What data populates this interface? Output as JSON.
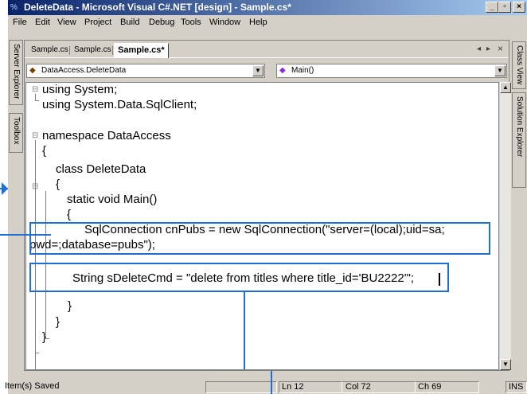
{
  "window": {
    "title": "DeleteData - Microsoft Visual C#.NET [design] - Sample.cs*",
    "controls": {
      "minimize": "_",
      "maximize": "▫",
      "close": "×"
    }
  },
  "menu": [
    {
      "label": "File"
    },
    {
      "label": "Edit"
    },
    {
      "label": "View"
    },
    {
      "label": "Project"
    },
    {
      "label": "Build"
    },
    {
      "label": "Debug"
    },
    {
      "label": "Tools"
    },
    {
      "label": "Window"
    },
    {
      "label": "Help"
    }
  ],
  "left_rail": {
    "server_explorer": "Server Explorer",
    "toolbox": "Toolbox"
  },
  "right_rail": {
    "class_view": "Class View",
    "solution_explorer": "Solution Explorer"
  },
  "tabs": [
    {
      "label": "Sample.cs",
      "active": false
    },
    {
      "label": "Sample.cs",
      "active": false
    },
    {
      "label": "Sample.cs*",
      "active": true
    }
  ],
  "tab_nav": {
    "prev": "◂",
    "next": "▸",
    "close": "×"
  },
  "combos": {
    "type": "DataAccess.DeleteData",
    "member": "Main()"
  },
  "code": {
    "line1": "using System;",
    "line2": "using System.Data.SqlClient;",
    "line3": "namespace DataAccess",
    "line4": "{",
    "line5": "class DeleteData",
    "line6": "{",
    "line7": "static void Main()",
    "line8": "{",
    "line9": "SqlConnection cnPubs = new SqlConnection(\"server=(local);uid=sa;",
    "line10": "pwd=;database=pubs\");",
    "line11": "String sDeleteCmd = \"delete from titles where title_id='BU2222'\";",
    "line12": "}",
    "line13": "}",
    "line14": "}"
  },
  "status": {
    "message": "Item(s) Saved",
    "line": "Ln 12",
    "col": "Col 72",
    "ch": "Ch 69",
    "mode": "INS"
  },
  "colors": {
    "callout": "#1f6fd0",
    "titlebar_start": "#0a246a",
    "titlebar_end": "#a6caf0"
  }
}
